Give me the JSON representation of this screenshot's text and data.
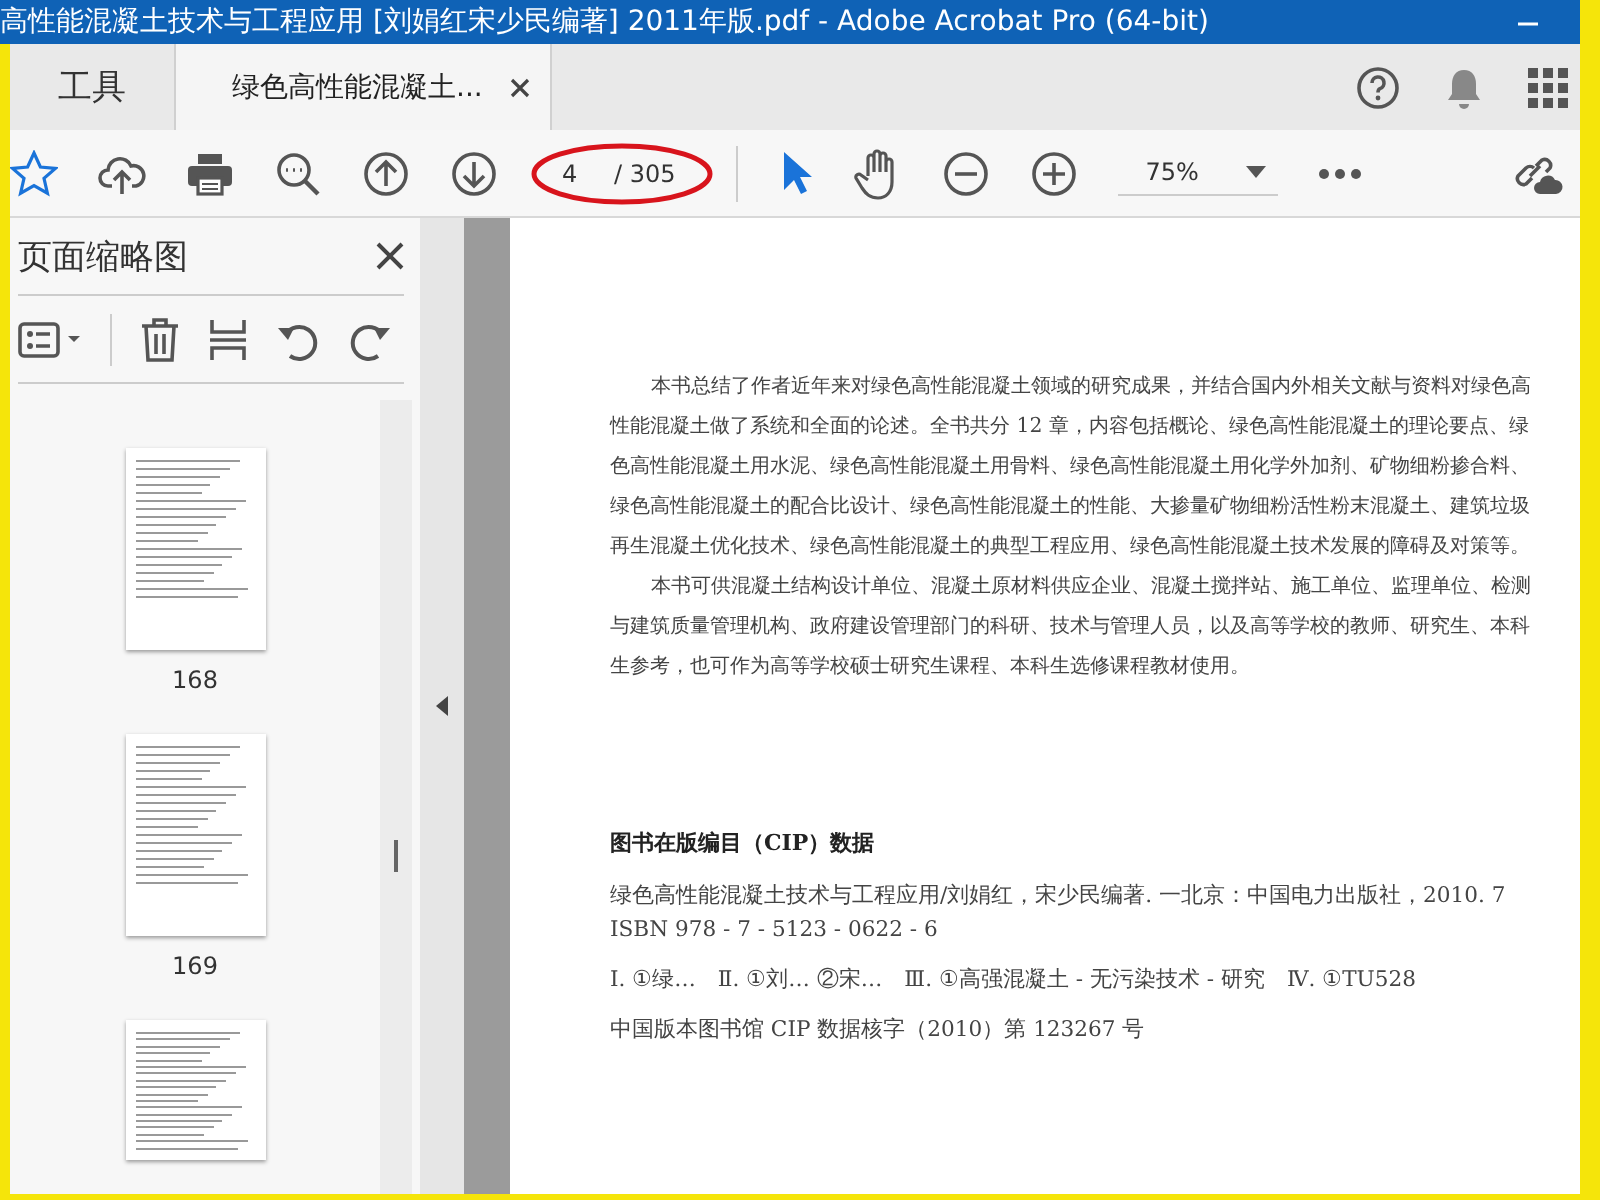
{
  "window": {
    "title": "高性能混凝土技术与工程应用 [刘娟红宋少民编著] 2011年版.pdf - Adobe Acrobat Pro (64-bit)"
  },
  "tabs": [
    {
      "label": "工具",
      "selected": false
    },
    {
      "label": "绿色高性能混凝土...",
      "selected": true
    }
  ],
  "toolbar": {
    "page_value": "4",
    "page_total": "/ 305",
    "zoom": "75%",
    "page_field_circled": true
  },
  "sidebar": {
    "title": "页面缩略图",
    "thumbnails": [
      {
        "label": "168",
        "cut_off": false
      },
      {
        "label": "169",
        "cut_off": false
      },
      {
        "cut_off": true
      }
    ]
  },
  "document": {
    "paragraphs": [
      "本书总结了作者近年来对绿色高性能混凝土领域的研究成果，并结合国内外相关文献与资料对绿色高性能混凝土做了系统和全面的论述。全书共分 12 章，内容包括概论、绿色高性能混凝土的理论要点、绿色高性能混凝土用水泥、绿色高性能混凝土用骨料、绿色高性能混凝土用化学外加剂、矿物细粉掺合料、绿色高性能混凝土的配合比设计、绿色高性能混凝土的性能、大掺量矿物细粉活性粉末混凝土、建筑垃圾再生混凝土优化技术、绿色高性能混凝土的典型工程应用、绿色高性能混凝土技术发展的障碍及对策等。",
      "本书可供混凝土结构设计单位、混凝土原材料供应企业、混凝土搅拌站、施工单位、监理单位、检测与建筑质量管理机构、政府建设管理部门的科研、技术与管理人员，以及高等学校的教师、研究生、本科生参考，也可作为高等学校硕士研究生课程、本科生选修课程教材使用。"
    ],
    "cip_heading": "图书在版编目（CIP）数据",
    "cip_lines": [
      "绿色高性能混凝土技术与工程应用/刘娟红，宋少民编著. 一北京：中国电力出版社，2010. 7",
      "ISBN 978 - 7 - 5123 - 0622 - 6",
      "Ⅰ. ①绿…　Ⅱ. ①刘… ②宋…　Ⅲ. ①高强混凝土 - 无污染技术 - 研究　Ⅳ. ①TU528",
      "中国版本图书馆 CIP 数据核字（2010）第 123267 号"
    ]
  }
}
